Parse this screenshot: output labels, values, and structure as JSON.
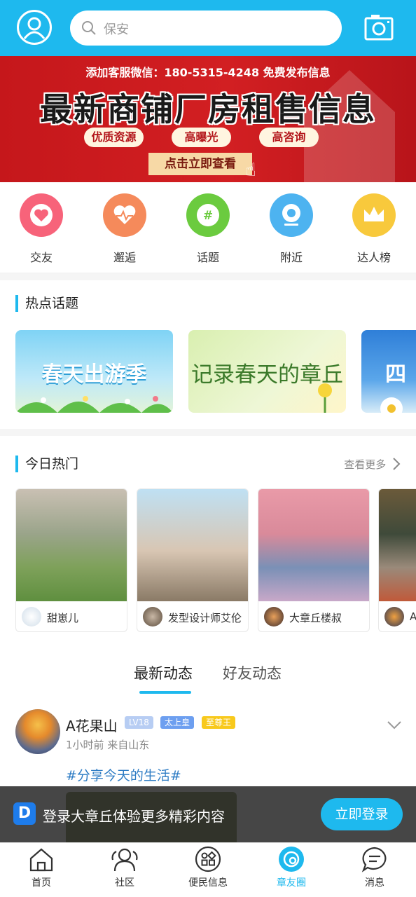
{
  "header": {
    "search_placeholder": "保安"
  },
  "banner": {
    "top_line": "添加客服微信：180-5315-4248 免费发布信息",
    "title": "最新商铺厂房租售信息",
    "tags": [
      "优质资源",
      "高曝光",
      "高咨询"
    ],
    "cta": "点击立即查看"
  },
  "categories": [
    {
      "label": "交友",
      "color": "#F7637A",
      "icon": "heart-icon"
    },
    {
      "label": "邂逅",
      "color": "#F58A5B",
      "icon": "heartbeat-icon"
    },
    {
      "label": "话题",
      "color": "#6BCB3F",
      "icon": "hashtag-icon"
    },
    {
      "label": "附近",
      "color": "#4DB3F0",
      "icon": "location-icon"
    },
    {
      "label": "达人榜",
      "color": "#F8C93C",
      "icon": "crown-icon"
    }
  ],
  "hot_topics": {
    "title": "热点话题",
    "items": [
      "春天出游季",
      "记录春天的章丘",
      "四"
    ]
  },
  "today_hot": {
    "title": "今日热门",
    "more": "查看更多",
    "items": [
      {
        "name": "甜崽儿"
      },
      {
        "name": "发型设计师艾伦"
      },
      {
        "name": "大章丘楼叔"
      },
      {
        "name": "A"
      }
    ]
  },
  "tabs": [
    "最新动态",
    "好友动态"
  ],
  "post": {
    "author": "A花果山",
    "badges": [
      "LV18",
      "太上皇",
      "至尊王"
    ],
    "meta": "1小时前  来自山东",
    "tag": "#分享今天的生活#"
  },
  "login_bar": {
    "logo": "D",
    "text": "登录大章丘体验更多精彩内容",
    "button": "立即登录"
  },
  "nav": [
    {
      "label": "首页",
      "icon": "home-icon"
    },
    {
      "label": "社区",
      "icon": "community-icon"
    },
    {
      "label": "便民信息",
      "icon": "grid-icon"
    },
    {
      "label": "章友圈",
      "icon": "circle-icon",
      "active": true
    },
    {
      "label": "消息",
      "icon": "message-icon"
    }
  ],
  "colors": {
    "accent": "#1EB9EE",
    "banner_red": "#C5171B",
    "hashtag": "#2E7CC4"
  }
}
